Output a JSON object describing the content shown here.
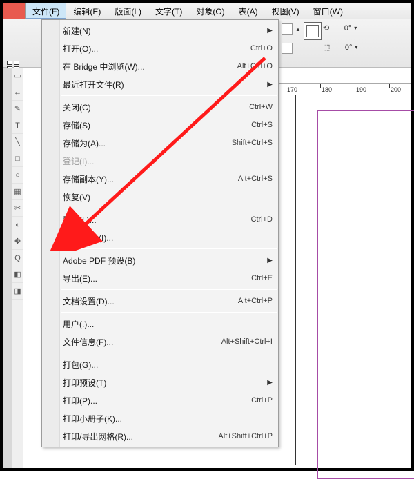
{
  "menubar": {
    "items": [
      {
        "label": "文件(F)",
        "active": true
      },
      {
        "label": "编辑(E)"
      },
      {
        "label": "版面(L)"
      },
      {
        "label": "文字(T)"
      },
      {
        "label": "对象(O)"
      },
      {
        "label": "表(A)"
      },
      {
        "label": "视图(V)"
      },
      {
        "label": "窗口(W)"
      }
    ]
  },
  "toolbar": {
    "rotate1": "0°",
    "rotate2": "0°"
  },
  "ruler": {
    "marks": [
      "170",
      "180",
      "190",
      "200"
    ]
  },
  "file_menu": [
    {
      "label": "新建(N)",
      "submenu": true
    },
    {
      "label": "打开(O)...",
      "shortcut": "Ctrl+O"
    },
    {
      "label": "在 Bridge 中浏览(W)...",
      "shortcut": "Alt+Ctrl+O"
    },
    {
      "label": "最近打开文件(R)",
      "submenu": true
    },
    {
      "sep": true
    },
    {
      "label": "关闭(C)",
      "shortcut": "Ctrl+W"
    },
    {
      "label": "存储(S)",
      "shortcut": "Ctrl+S"
    },
    {
      "label": "存储为(A)...",
      "shortcut": "Shift+Ctrl+S"
    },
    {
      "label": "登记(I)...",
      "disabled": true
    },
    {
      "label": "存储副本(Y)...",
      "shortcut": "Alt+Ctrl+S"
    },
    {
      "label": "恢复(V)"
    },
    {
      "sep": true
    },
    {
      "label": "置入(L)...",
      "shortcut": "Ctrl+D"
    },
    {
      "label": "导入 XML(I)..."
    },
    {
      "sep": true
    },
    {
      "label": "Adobe PDF 预设(B)",
      "submenu": true
    },
    {
      "label": "导出(E)...",
      "shortcut": "Ctrl+E"
    },
    {
      "sep": true
    },
    {
      "label": "文档设置(D)...",
      "shortcut": "Alt+Ctrl+P"
    },
    {
      "sep": true
    },
    {
      "label": "用户(.)..."
    },
    {
      "label": "文件信息(F)...",
      "shortcut": "Alt+Shift+Ctrl+I"
    },
    {
      "sep": true
    },
    {
      "label": "打包(G)..."
    },
    {
      "label": "打印预设(T)",
      "submenu": true
    },
    {
      "label": "打印(P)...",
      "shortcut": "Ctrl+P"
    },
    {
      "label": "打印小册子(K)..."
    },
    {
      "label": "打印/导出网格(R)...",
      "shortcut": "Alt+Shift+Ctrl+P"
    }
  ]
}
